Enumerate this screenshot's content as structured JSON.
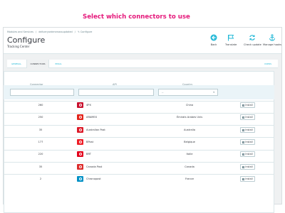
{
  "breadcrumb": [
    "Modules and Services",
    "/",
    "deliveryordersmassupdated",
    "/",
    "✎ Configure"
  ],
  "header": {
    "title": "Configure",
    "subtitle": "Tracking Center",
    "promo": "Select which connectors to use"
  },
  "toolbar": [
    {
      "label": "Back",
      "icon": "back-arrow-icon"
    },
    {
      "label": "Translate",
      "icon": "flag-icon"
    },
    {
      "label": "Check update",
      "icon": "refresh-icon"
    },
    {
      "label": "Manage hooks",
      "icon": "anchor-icon"
    }
  ],
  "tabs": [
    {
      "label": "GENERAL",
      "active": false
    },
    {
      "label": "CONNECTORS",
      "active": true
    },
    {
      "label": "EMAIL",
      "active": false
    },
    {
      "label": "USERS",
      "active": false
    }
  ],
  "table": {
    "headers": {
      "connector": "Connector",
      "api": "API",
      "country": "Country"
    },
    "country_select_value": "--",
    "rows": [
      {
        "id": "260",
        "name": "4PX",
        "country": "China",
        "logo_color": "#c8102e",
        "logo_fg": "#ffffff"
      },
      {
        "id": "250",
        "name": "ARAMEX",
        "country": "Émirats Arabes Unis",
        "logo_color": "#e2231a",
        "logo_fg": "#ffffff"
      },
      {
        "id": "35",
        "name": "Australian Post",
        "country": "Australia",
        "logo_color": "#dc1928",
        "logo_fg": "#ffffff"
      },
      {
        "id": "177",
        "name": "BPost",
        "country": "Belgique",
        "logo_color": "#ee1c25",
        "logo_fg": "#ffffff"
      },
      {
        "id": "220",
        "name": "BRT",
        "country": "Italie",
        "logo_color": "#e3001b",
        "logo_fg": "#ffffff"
      },
      {
        "id": "35",
        "name": "Canada Post",
        "country": "Canada",
        "logo_color": "#dc2c2c",
        "logo_fg": "#ffffff"
      },
      {
        "id": "2",
        "name": "Chronopost",
        "country": "France",
        "logo_color": "#0091c6",
        "logo_fg": "#ffffff"
      }
    ],
    "install_label": "Install"
  },
  "colors": {
    "accent": "#25b9d7",
    "promo": "#e5197b"
  }
}
